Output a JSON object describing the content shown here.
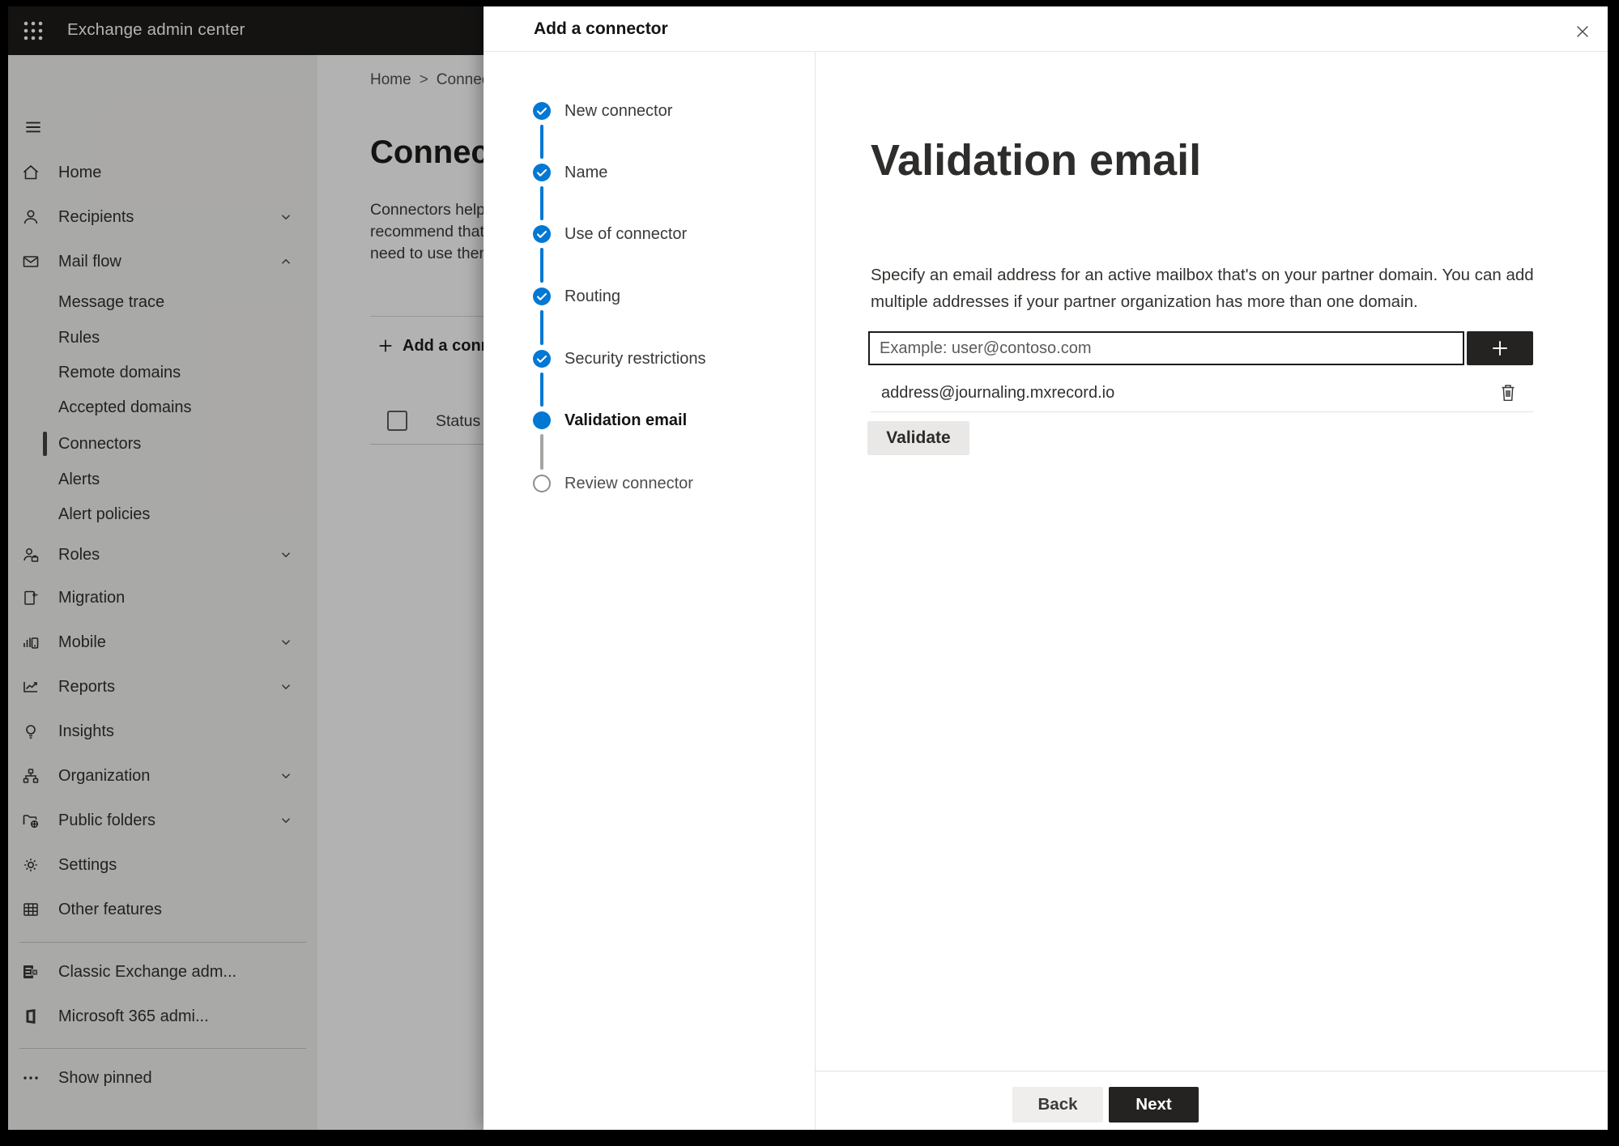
{
  "chrome": {
    "app_title": "Exchange admin center"
  },
  "sidebar": {
    "items": [
      {
        "label": "Home"
      },
      {
        "label": "Recipients"
      },
      {
        "label": "Mail flow"
      },
      {
        "label": "Message trace"
      },
      {
        "label": "Rules"
      },
      {
        "label": "Remote domains"
      },
      {
        "label": "Accepted domains"
      },
      {
        "label": "Connectors"
      },
      {
        "label": "Alerts"
      },
      {
        "label": "Alert policies"
      },
      {
        "label": "Roles"
      },
      {
        "label": "Migration"
      },
      {
        "label": "Mobile"
      },
      {
        "label": "Reports"
      },
      {
        "label": "Insights"
      },
      {
        "label": "Organization"
      },
      {
        "label": "Public folders"
      },
      {
        "label": "Settings"
      },
      {
        "label": "Other features"
      },
      {
        "label": "Classic Exchange adm..."
      },
      {
        "label": "Microsoft 365 admi..."
      },
      {
        "label": "Show pinned"
      }
    ]
  },
  "page": {
    "breadcrumb": {
      "home": "Home",
      "separator": ">",
      "current": "Connectors"
    },
    "title": "Connectors",
    "intro_line1": "Connectors help",
    "intro_line2": "recommend that",
    "intro_line3": "need to use them",
    "add_button": "Add a connector",
    "status_header": "Status"
  },
  "panel": {
    "title": "Add a connector",
    "steps": [
      {
        "label": "New connector",
        "state": "completed"
      },
      {
        "label": "Name",
        "state": "completed"
      },
      {
        "label": "Use of connector",
        "state": "completed"
      },
      {
        "label": "Routing",
        "state": "completed"
      },
      {
        "label": "Security restrictions",
        "state": "completed"
      },
      {
        "label": "Validation email",
        "state": "current"
      },
      {
        "label": "Review connector",
        "state": "upcoming"
      }
    ],
    "content": {
      "heading": "Validation email",
      "description_line1": "Specify an email address for an active mailbox that's on your partner domain. You can add",
      "description_line2": "multiple addresses if your partner organization has more than one domain.",
      "input_placeholder": "Example: user@contoso.com",
      "added_address": "address@journaling.mxrecord.io",
      "validate_label": "Validate"
    },
    "footer": {
      "back_label": "Back",
      "next_label": "Next"
    }
  },
  "colors": {
    "accent": "#0078d4",
    "topbar": "#1d1c1b",
    "sidebar_bg": "#f3f2f1",
    "dark_button": "#252321"
  }
}
